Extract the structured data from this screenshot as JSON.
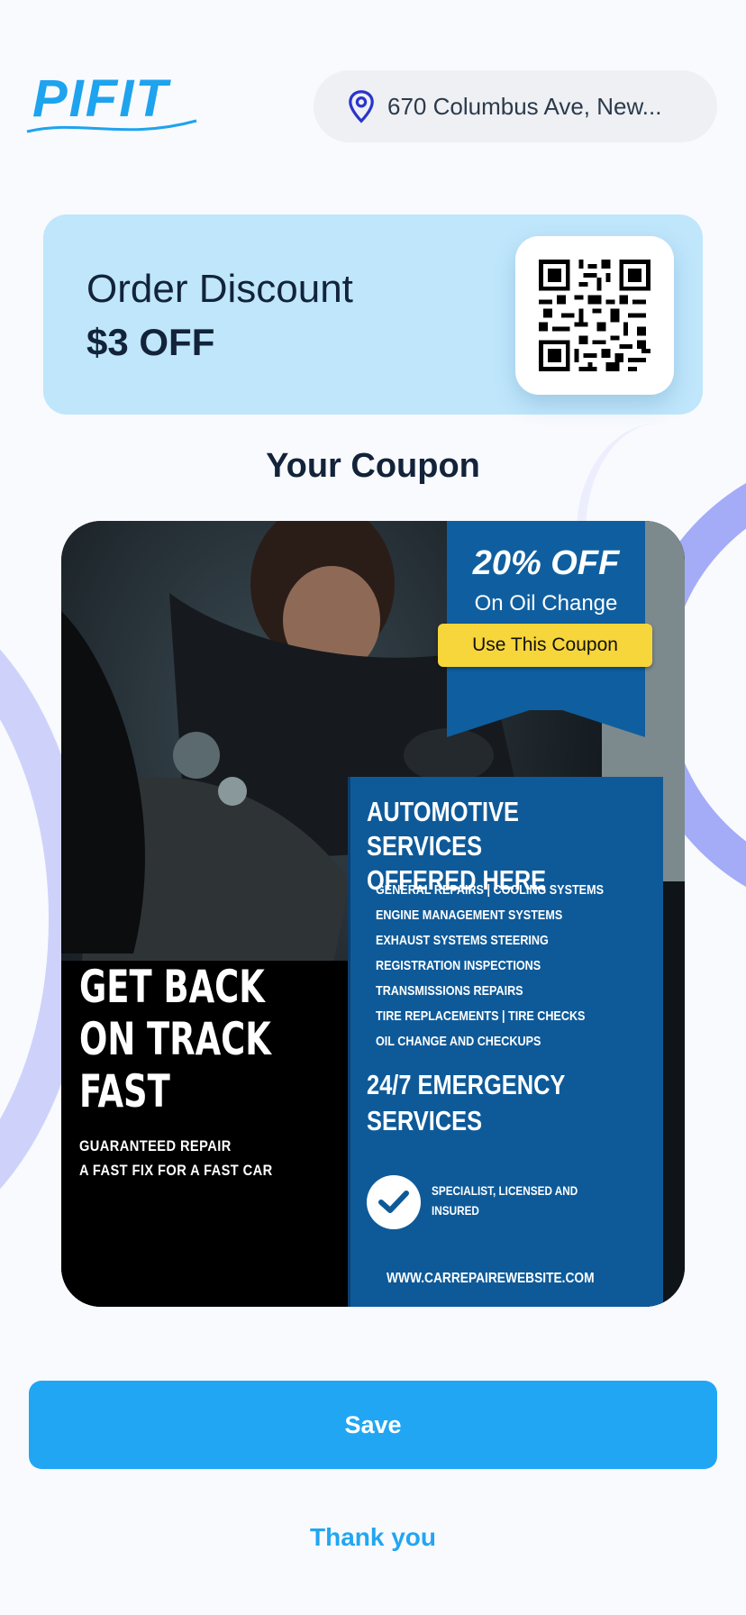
{
  "header": {
    "logo_text": "PIFIT",
    "location": "670 Columbus Ave, New...",
    "location_icon": "map-pin-icon"
  },
  "discount": {
    "title": "Order Discount",
    "value": "$3 OFF",
    "qr_icon": "qr-code-icon"
  },
  "coupon": {
    "heading": "Your Coupon",
    "ribbon_percent": "20% OFF",
    "ribbon_subtitle": "On Oil Change",
    "use_button": "Use This Coupon",
    "headline_lines": [
      "GET BACK",
      "ON TRACK",
      "FAST"
    ],
    "guarantee_lines": [
      "GUARANTEED REPAIR",
      "A FAST FIX FOR A FAST CAR"
    ],
    "services_title_lines": [
      "AUTOMOTIVE SERVICES",
      "OFFERED HERE"
    ],
    "services": [
      "GENERAL REPAIRS | COOLING SYSTEMS",
      "ENGINE MANAGEMENT SYSTEMS",
      "EXHAUST SYSTEMS STEERING",
      "REGISTRATION INSPECTIONS",
      "TRANSMISSIONS REPAIRS",
      "TIRE REPLACEMENTS | TIRE CHECKS",
      "OIL CHANGE AND CHECKUPS"
    ],
    "emergency_lines": [
      "24/7 EMERGENCY",
      "SERVICES"
    ],
    "specialist_lines": [
      "SPECIALIST, LICENSED AND",
      "INSURED"
    ],
    "website": "WWW.CARREPAIREWEBSITE.COM"
  },
  "actions": {
    "save_label": "Save",
    "thank_label": "Thank you"
  },
  "colors": {
    "accent": "#21a6f3",
    "discount_card": "#bfe6fb",
    "coupon_blue": "#0e5a99",
    "coupon_yellow": "#f7d63b"
  }
}
